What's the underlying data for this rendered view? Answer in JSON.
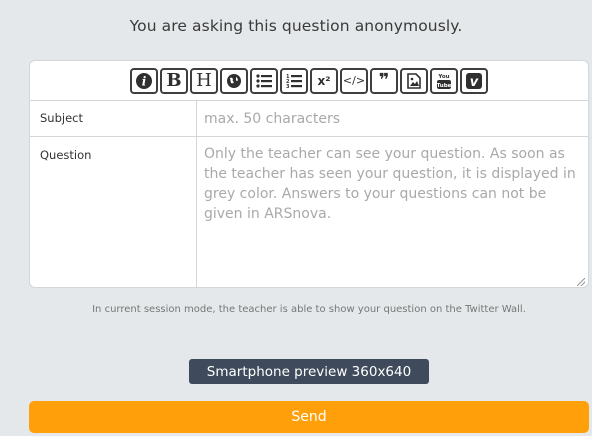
{
  "header": {
    "anonymous_note": "You are asking this question anonymously."
  },
  "toolbar": {
    "buttons": [
      {
        "name": "info",
        "glyph": "i"
      },
      {
        "name": "bold",
        "glyph": "B"
      },
      {
        "name": "heading",
        "glyph": "H"
      },
      {
        "name": "link",
        "glyph": ""
      },
      {
        "name": "unordered-list",
        "glyph": ""
      },
      {
        "name": "ordered-list",
        "glyph": ""
      },
      {
        "name": "superscript",
        "glyph": "x²"
      },
      {
        "name": "code",
        "glyph": "</>"
      },
      {
        "name": "quote",
        "glyph": "❞"
      },
      {
        "name": "image",
        "glyph": ""
      },
      {
        "name": "youtube",
        "glyph": "You Tube"
      },
      {
        "name": "vimeo",
        "glyph": "v"
      }
    ]
  },
  "form": {
    "subject_label": "Subject",
    "subject_placeholder": "max. 50 characters",
    "question_label": "Question",
    "question_placeholder": "Only the teacher can see your question. As soon as the teacher has seen your question, it is displayed in grey color. Answers to your questions can not be given in ARSnova."
  },
  "twitter_note": "In current session mode, the teacher is able to show your question on the Twitter Wall.",
  "preview_button": "Smartphone preview 360x640",
  "send_button": "Send",
  "colors": {
    "accent": "#ffa00a",
    "dark_button": "#3f4b5c",
    "background": "#e4e8ea"
  }
}
